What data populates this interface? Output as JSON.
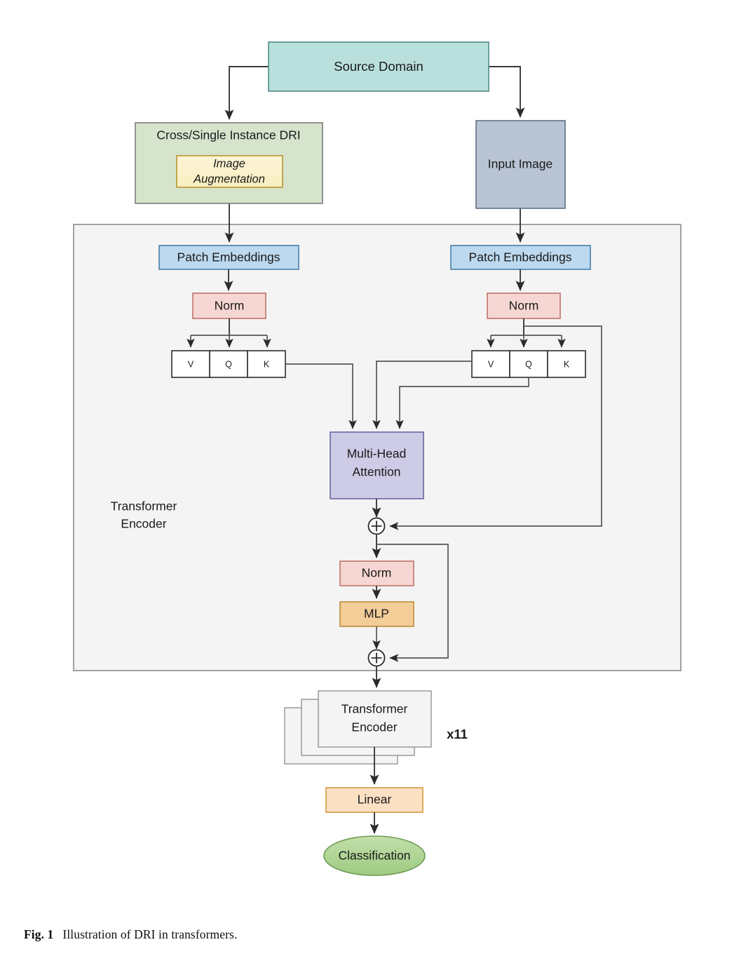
{
  "figure": {
    "caption_label": "Fig. 1",
    "caption_text": "Illustration of DRI in transformers."
  },
  "nodes": {
    "source_domain": "Source Domain",
    "dri_block": "Cross/Single Instance DRI",
    "image_augmentation_line1": "Image",
    "image_augmentation_line2": "Augmentation",
    "input_image": "Input Image",
    "patch_embeddings_left": "Patch Embeddings",
    "patch_embeddings_right": "Patch Embeddings",
    "norm_left": "Norm",
    "norm_right": "Norm",
    "vqk_left": [
      "V",
      "Q",
      "K"
    ],
    "vqk_right": [
      "V",
      "Q",
      "K"
    ],
    "attention_line1": "Multi-Head",
    "attention_line2": "Attention",
    "encoder_panel_line1": "Transformer",
    "encoder_panel_line2": "Encoder",
    "norm_mlp_norm": "Norm",
    "mlp": "MLP",
    "encoder_stack_line1": "Transformer",
    "encoder_stack_line2": "Encoder",
    "encoder_stack_multiplier": "x11",
    "linear": "Linear",
    "classification": "Classification",
    "add_symbol_1": "+",
    "add_symbol_2": "+"
  },
  "colors": {
    "source_domain_fill": "#b9e0dd",
    "source_domain_stroke": "#4f8a86",
    "dri_fill": "#d6e4cd",
    "dri_stroke": "#7c7c7c",
    "augmentation_fill": "#fdf2cd",
    "augmentation_stroke": "#b5962f",
    "input_image_fill": "#b8c4d3",
    "input_image_stroke": "#5f7184",
    "panel_fill": "#f4f4f4",
    "panel_stroke": "#8c8c8c",
    "patch_fill": "#bcd9ef",
    "patch_stroke": "#4a7fa8",
    "norm_fill": "#f6d6d3",
    "norm_stroke": "#c0736a",
    "vqk_fill": "#ffffff",
    "vqk_stroke": "#2d2d2d",
    "attention_fill": "#cdcbe6",
    "attention_stroke": "#6a679d",
    "mlp_fill": "#f2cd98",
    "mlp_stroke": "#c08c38",
    "linear_fill": "#fbe0c4",
    "linear_stroke": "#d59a3c",
    "classification_fill": "#aed394",
    "classification_stroke": "#6d9a54",
    "stack_fill": "#f4f4f4",
    "stack_stroke": "#8c8c8c",
    "edge_stroke": "#3a3a3a"
  }
}
